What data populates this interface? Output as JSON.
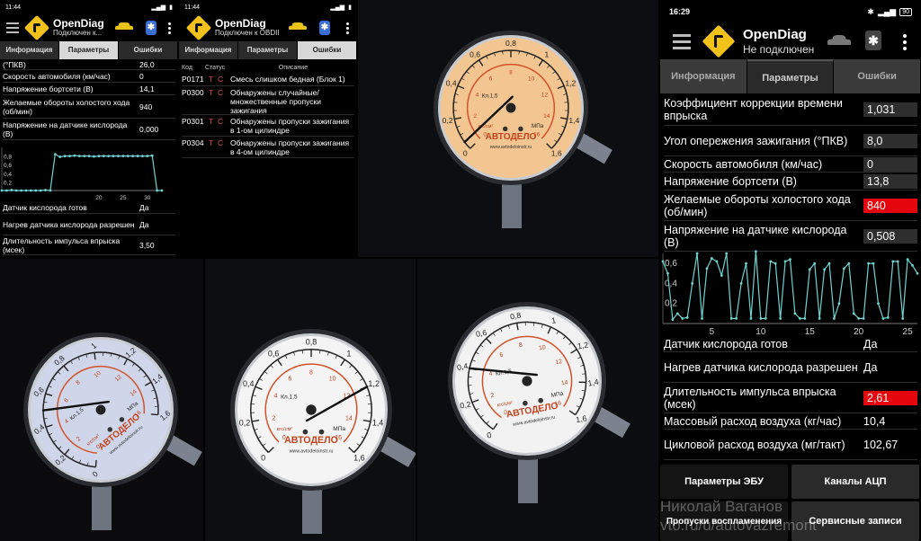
{
  "app": {
    "name": "OpenDiag"
  },
  "screen1": {
    "time": "11:44",
    "status": "Подключен к...",
    "tabs": [
      {
        "label": "Информация"
      },
      {
        "label": "Параметры"
      },
      {
        "label": "Ошибки"
      }
    ],
    "active_tab": 1,
    "rows_top": [
      {
        "label": "(°ПКВ)",
        "value": "26,0"
      },
      {
        "label": "Скорость автомобиля (км/час)",
        "value": "0"
      },
      {
        "label": "Напряжение бортсети (В)",
        "value": "14,1"
      },
      {
        "label": "Желаемые обороты холостого хода (об/мин)",
        "value": "940"
      },
      {
        "label": "Напряжение на датчике кислорода (В)",
        "value": "0,000"
      }
    ],
    "chart_data": {
      "type": "line",
      "title": "",
      "xlabel": "",
      "ylabel": "",
      "x": [
        0,
        1,
        2,
        3,
        4,
        5,
        6,
        7,
        8,
        9,
        10,
        11,
        12,
        13,
        14,
        15,
        16,
        17,
        18,
        19,
        20,
        21,
        22,
        23,
        24,
        25,
        26,
        27,
        28,
        29,
        30,
        31,
        32,
        33
      ],
      "values": [
        0,
        0,
        0.01,
        0,
        0,
        0,
        0,
        0,
        0,
        0.01,
        0,
        0.84,
        0.78,
        0.8,
        0.8,
        0.81,
        0.8,
        0.8,
        0.8,
        0.79,
        0.8,
        0.8,
        0.8,
        0.8,
        0.8,
        0.8,
        0.8,
        0.8,
        0.8,
        0.8,
        0.8,
        0.81,
        0,
        0
      ],
      "xlim": [
        0,
        33
      ],
      "ylim": [
        0,
        1
      ],
      "xticks": [
        {
          "v": 20,
          "label": "20"
        },
        {
          "v": 25,
          "label": "25"
        },
        {
          "v": 30,
          "label": "30"
        }
      ],
      "yticks": [
        {
          "v": 0.2,
          "label": "0,2"
        },
        {
          "v": 0.4,
          "label": "0,4"
        },
        {
          "v": 0.6,
          "label": "0,6"
        },
        {
          "v": 0.8,
          "label": "0,8"
        }
      ],
      "grid": false,
      "color": "#6fd3d0"
    },
    "rows_bottom": [
      {
        "label": "Датчик кислорода готов",
        "value": "Да"
      },
      {
        "label": "Нагрев датчика кислорода разрешен",
        "value": "Да"
      },
      {
        "label": "Длительность импульса впрыска (мсек)",
        "value": "3,50"
      }
    ]
  },
  "screen2": {
    "time": "11:44",
    "status": "Подключен к OBDII",
    "tabs": [
      {
        "label": "Информация"
      },
      {
        "label": "Параметры"
      },
      {
        "label": "Ошибки"
      }
    ],
    "active_tab": 2,
    "columns": {
      "code": "Код",
      "status": "Статус",
      "desc": "Описание"
    },
    "errors": [
      {
        "code": "P0171",
        "t": "T",
        "c": "C",
        "desc": "Смесь слишком бедная (Блок 1)"
      },
      {
        "code": "P0300",
        "t": "T",
        "c": "C",
        "desc": "Обнаружены случайные/ множественные пропуски зажигания"
      },
      {
        "code": "P0301",
        "t": "T",
        "c": "C",
        "desc": "Обнаружены пропуски зажигания в 1-ом цилиндре"
      },
      {
        "code": "P0304",
        "t": "T",
        "c": "C",
        "desc": "Обнаружены пропуски зажигания в 4-ом цилиндре"
      }
    ]
  },
  "screen3": {
    "time": "16:29",
    "battery": "90",
    "status": "Не подключен",
    "tabs": [
      {
        "label": "Информация"
      },
      {
        "label": "Параметры"
      },
      {
        "label": "Ошибки"
      }
    ],
    "active_tab": 1,
    "rows_top": [
      {
        "label": "Коэффициент коррекции времени впрыска",
        "value": "1,031",
        "alert": false
      },
      {
        "label": "Угол опережения зажигания (°ПКВ)",
        "value": "8,0",
        "alert": false
      },
      {
        "label": "Скорость автомобиля (км/час)",
        "value": "0",
        "alert": false
      },
      {
        "label": "Напряжение бортсети (В)",
        "value": "13,8",
        "alert": false
      },
      {
        "label": "Желаемые обороты холостого хода (об/мин)",
        "value": "840",
        "alert": true
      },
      {
        "label": "Напряжение на датчике кислорода (В)",
        "value": "0,508",
        "alert": false
      }
    ],
    "chart_data": {
      "type": "line",
      "title": "",
      "xlabel": "",
      "ylabel": "",
      "x": [
        0,
        0.5,
        1,
        1.5,
        2,
        2.5,
        3,
        3.5,
        4,
        4.5,
        5,
        5.5,
        6,
        6.5,
        7,
        7.5,
        8,
        8.5,
        9,
        9.5,
        10,
        10.5,
        11,
        11.5,
        12,
        12.5,
        13,
        13.5,
        14,
        14.5,
        15,
        15.5,
        16,
        16.5,
        17,
        17.5,
        18,
        18.5,
        19,
        19.5,
        20,
        20.5,
        21,
        21.5,
        22,
        22.5,
        23,
        23.5,
        24,
        24.5,
        25,
        25.5,
        26
      ],
      "values": [
        0.62,
        0.5,
        0.04,
        0.1,
        0.05,
        0.06,
        0.4,
        0.7,
        0.05,
        0.55,
        0.65,
        0.62,
        0.48,
        0.7,
        0.05,
        0.05,
        0.4,
        0.6,
        0.05,
        0.72,
        0.05,
        0.05,
        0.62,
        0.6,
        0.05,
        0.62,
        0.64,
        0.1,
        0.05,
        0.05,
        0.54,
        0.6,
        0.05,
        0.54,
        0.6,
        0.05,
        0.2,
        0.55,
        0.6,
        0.1,
        0.05,
        0.05,
        0.6,
        0.6,
        0.2,
        0.05,
        0.06,
        0.62,
        0.62,
        0.05,
        0.64,
        0.58,
        0.5
      ],
      "xlim": [
        0,
        26
      ],
      "ylim": [
        0,
        0.7
      ],
      "xticks": [
        {
          "v": 5,
          "label": "5"
        },
        {
          "v": 10,
          "label": "10"
        },
        {
          "v": 15,
          "label": "15"
        },
        {
          "v": 20,
          "label": "20"
        },
        {
          "v": 25,
          "label": "25"
        }
      ],
      "yticks": [
        {
          "v": 0.2,
          "label": "0,2"
        },
        {
          "v": 0.4,
          "label": "0,4"
        },
        {
          "v": 0.6,
          "label": "0,6"
        }
      ],
      "grid": false,
      "color": "#6fd3d0"
    },
    "rows_bottom": [
      {
        "label": "Датчик кислорода готов",
        "value": "Да",
        "alert": false
      },
      {
        "label": "Нагрев датчика кислорода разрешен",
        "value": "Да",
        "alert": false
      },
      {
        "label": "Длительность импульса впрыска (мсек)",
        "value": "2,61",
        "alert": true
      },
      {
        "label": "Массовый расход воздуха (кг/час)",
        "value": "10,4",
        "alert": false
      },
      {
        "label": "Цикловой расход воздуха (мг/такт)",
        "value": "102,67",
        "alert": false
      }
    ],
    "buttons": {
      "ecu": "Параметры ЭБУ",
      "adc": "Каналы АЦП",
      "misfire": "Пропуски воспламенения",
      "service": "Сервисные записи"
    },
    "watermark": {
      "line1": "Николай Ваганов",
      "line2": "vto.ru/u/autovazremont"
    }
  },
  "gauge": {
    "brand": "АВТОДЕЛО",
    "unit": "МПа",
    "unit2": "кгс/см²",
    "class": "Кл.1,5",
    "site": "www.avtodeloinstr.ru",
    "ticks": [
      "0",
      "0,2",
      "0,4",
      "0,6",
      "0,8",
      "1",
      "1,2",
      "1,4",
      "1,6"
    ],
    "ticks_small": [
      "0",
      "2",
      "4",
      "6",
      "8",
      "10",
      "12",
      "14",
      "16"
    ],
    "readings": [
      0.05,
      0.5,
      1.2,
      0.4
    ]
  }
}
